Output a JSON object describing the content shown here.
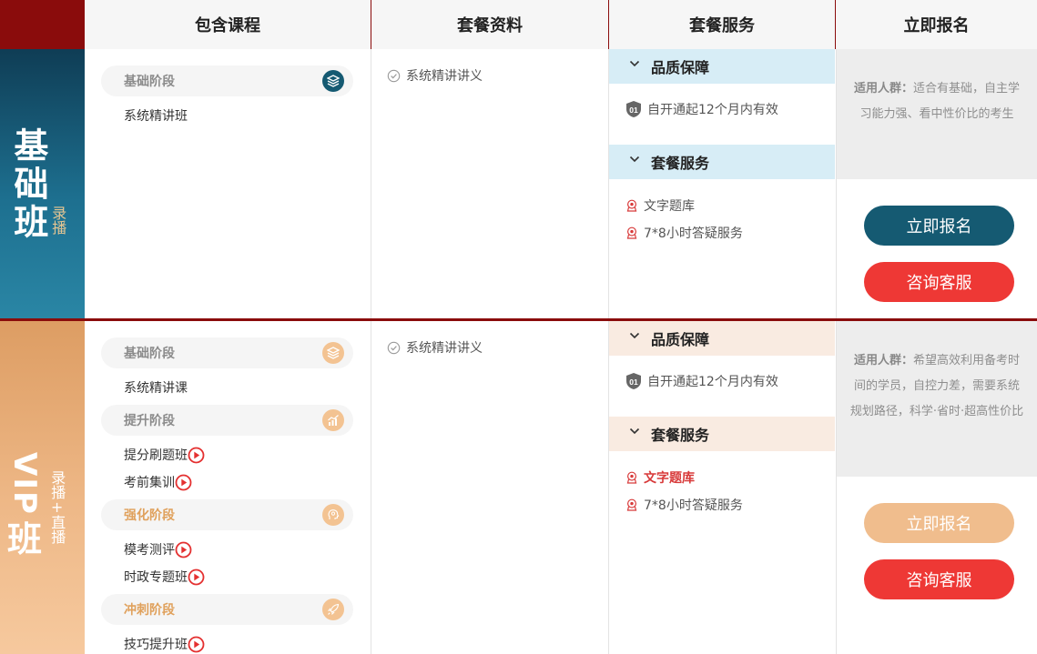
{
  "header": {
    "courses": "包含课程",
    "materials": "套餐资料",
    "services": "套餐服务",
    "signup": "立即报名"
  },
  "basic": {
    "title": "基础班",
    "tag": "录播",
    "stages": [
      {
        "label": "基础阶段",
        "icon": "layers-icon",
        "courses": [
          "系统精讲班"
        ]
      }
    ],
    "materials": [
      "系统精讲讲义"
    ],
    "quality_head": "品质保障",
    "quality_badge": "01",
    "quality_item": "自开通起12个月内有效",
    "service_head": "套餐服务",
    "services": [
      "文字题库",
      "7*8小时答疑服务"
    ],
    "target_label": "适用人群：",
    "target_text": "适合有基础，自主学习能力强、看中性价比的考生",
    "enroll_button": "立即报名",
    "consult_button": "咨询客服"
  },
  "vip": {
    "title_latin": "VIP",
    "title_cn": "班",
    "tag_top": "录播",
    "tag_plus": "+",
    "tag_bottom": "直播",
    "stages": [
      {
        "label": "基础阶段",
        "icon": "layers-icon",
        "courses": [
          "系统精讲课"
        ]
      },
      {
        "label": "提升阶段",
        "icon": "rising-chart-icon",
        "courses": [
          "提分刷题班",
          "考前集训"
        ]
      },
      {
        "label": "强化阶段",
        "icon": "lightbulb-head-icon",
        "courses": [
          "模考测评",
          "时政专题班"
        ]
      },
      {
        "label": "冲刺阶段",
        "icon": "rocket-icon",
        "courses": [
          "技巧提升班"
        ]
      }
    ],
    "materials": [
      "系统精讲讲义"
    ],
    "quality_head": "品质保障",
    "quality_badge": "01",
    "quality_item": "自开通起12个月内有效",
    "service_head": "套餐服务",
    "services": [
      "文字题库",
      "7*8小时答疑服务"
    ],
    "target_label": "适用人群：",
    "target_text": "希望高效利用备考时间的学员，自控力差，需要系统规划路径，科学·省时·超高性价比",
    "enroll_button": "立即报名",
    "consult_button": "咨询客服"
  },
  "colors": {
    "header_border": "#8a0c0c",
    "basic_accent": "#155a72",
    "vip_accent": "#f0bd8d",
    "consult_red": "#ee3835"
  }
}
